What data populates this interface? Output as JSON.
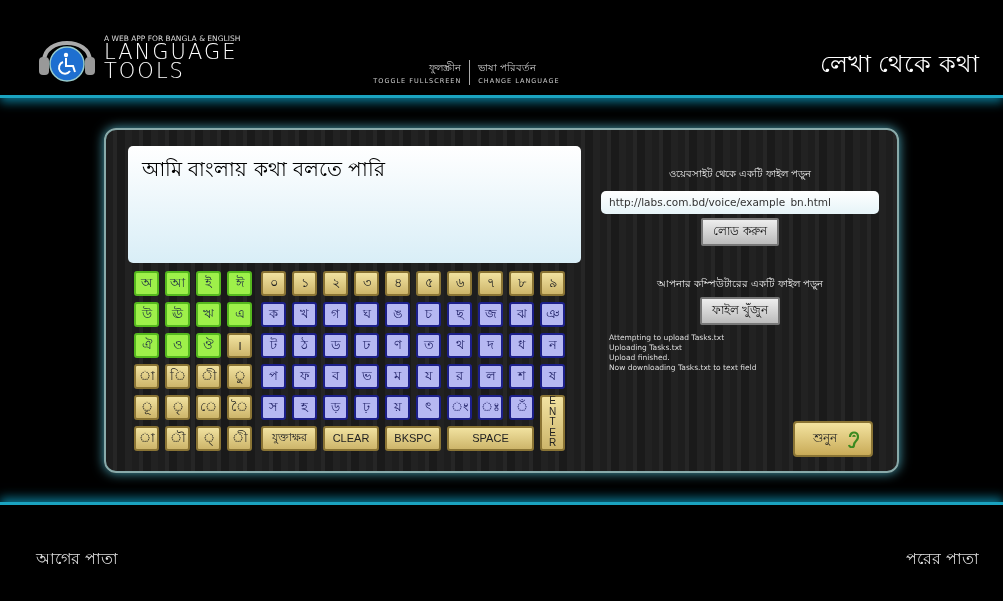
{
  "header": {
    "logo": {
      "tagline": "A WEB APP FOR BANGLA & ENGLISH",
      "line_1": "LANGUAGE",
      "line_2": "TOOLS"
    },
    "links": [
      {
        "bangla": "ফুলস্ক্রীন",
        "english": "TOGGLE FULLSCREEN"
      },
      {
        "bangla": "ভাষা পরিবর্তন",
        "english": "CHANGE LANGUAGE"
      }
    ],
    "title": "লেখা থেকে কথা"
  },
  "editor": {
    "text": "আমি বাংলায় কথা বলতে পারি"
  },
  "keyboard": {
    "left_rows": [
      [
        {
          "label": "অ",
          "kind": "vowel"
        },
        {
          "label": "আ",
          "kind": "vowel"
        },
        {
          "label": "ই",
          "kind": "vowel"
        },
        {
          "label": "ঈ",
          "kind": "vowel"
        }
      ],
      [
        {
          "label": "উ",
          "kind": "vowel"
        },
        {
          "label": "ঊ",
          "kind": "vowel"
        },
        {
          "label": "ঋ",
          "kind": "vowel"
        },
        {
          "label": "এ",
          "kind": "vowel"
        }
      ],
      [
        {
          "label": "ঐ",
          "kind": "vowel"
        },
        {
          "label": "ও",
          "kind": "vowel"
        },
        {
          "label": "ঔ",
          "kind": "vowel"
        },
        {
          "label": "।",
          "kind": "sign"
        }
      ],
      [
        {
          "label": "া",
          "kind": "sign"
        },
        {
          "label": "ি",
          "kind": "sign"
        },
        {
          "label": "ী",
          "kind": "sign"
        },
        {
          "label": "ু",
          "kind": "sign"
        }
      ],
      [
        {
          "label": "ূ",
          "kind": "sign"
        },
        {
          "label": "ৃ",
          "kind": "sign"
        },
        {
          "label": "ে",
          "kind": "sign"
        },
        {
          "label": "ৈ",
          "kind": "sign"
        }
      ],
      [
        {
          "label": "া",
          "kind": "sign"
        },
        {
          "label": "ৗ",
          "kind": "sign"
        },
        {
          "label": "্",
          "kind": "sign"
        },
        {
          "label": "ী",
          "kind": "sign"
        }
      ]
    ],
    "right_rows": [
      [
        {
          "label": "০",
          "kind": "digit"
        },
        {
          "label": "১",
          "kind": "digit"
        },
        {
          "label": "২",
          "kind": "digit"
        },
        {
          "label": "৩",
          "kind": "digit"
        },
        {
          "label": "৪",
          "kind": "digit"
        },
        {
          "label": "৫",
          "kind": "digit"
        },
        {
          "label": "৬",
          "kind": "digit"
        },
        {
          "label": "৭",
          "kind": "digit"
        },
        {
          "label": "৮",
          "kind": "digit"
        },
        {
          "label": "৯",
          "kind": "digit"
        }
      ],
      [
        {
          "label": "ক",
          "kind": "consonant"
        },
        {
          "label": "খ",
          "kind": "consonant"
        },
        {
          "label": "গ",
          "kind": "consonant"
        },
        {
          "label": "ঘ",
          "kind": "consonant"
        },
        {
          "label": "ঙ",
          "kind": "consonant"
        },
        {
          "label": "চ",
          "kind": "consonant"
        },
        {
          "label": "ছ",
          "kind": "consonant"
        },
        {
          "label": "জ",
          "kind": "consonant"
        },
        {
          "label": "ঝ",
          "kind": "consonant"
        },
        {
          "label": "ঞ",
          "kind": "consonant"
        }
      ],
      [
        {
          "label": "ট",
          "kind": "consonant"
        },
        {
          "label": "ঠ",
          "kind": "consonant"
        },
        {
          "label": "ড",
          "kind": "consonant"
        },
        {
          "label": "ঢ",
          "kind": "consonant"
        },
        {
          "label": "ণ",
          "kind": "consonant"
        },
        {
          "label": "ত",
          "kind": "consonant"
        },
        {
          "label": "থ",
          "kind": "consonant"
        },
        {
          "label": "দ",
          "kind": "consonant"
        },
        {
          "label": "ধ",
          "kind": "consonant"
        },
        {
          "label": "ন",
          "kind": "consonant"
        }
      ],
      [
        {
          "label": "প",
          "kind": "consonant"
        },
        {
          "label": "ফ",
          "kind": "consonant"
        },
        {
          "label": "ব",
          "kind": "consonant"
        },
        {
          "label": "ভ",
          "kind": "consonant"
        },
        {
          "label": "ম",
          "kind": "consonant"
        },
        {
          "label": "য",
          "kind": "consonant"
        },
        {
          "label": "র",
          "kind": "consonant"
        },
        {
          "label": "ল",
          "kind": "consonant"
        },
        {
          "label": "শ",
          "kind": "consonant"
        },
        {
          "label": "ষ",
          "kind": "consonant"
        }
      ],
      [
        {
          "label": "স",
          "kind": "consonant"
        },
        {
          "label": "হ",
          "kind": "consonant"
        },
        {
          "label": "ড়",
          "kind": "consonant"
        },
        {
          "label": "ঢ়",
          "kind": "consonant"
        },
        {
          "label": "য়",
          "kind": "consonant"
        },
        {
          "label": "ৎ",
          "kind": "consonant"
        },
        {
          "label": "ং",
          "kind": "consonant"
        },
        {
          "label": "ঃ",
          "kind": "consonant"
        },
        {
          "label": "ঁ",
          "kind": "consonant"
        },
        {
          "label": "ENTER",
          "kind": "enter"
        }
      ],
      [
        {
          "label": "যুক্তাক্ষর",
          "kind": "function"
        },
        {
          "label": "CLEAR",
          "kind": "function"
        },
        {
          "label": "BKSPC",
          "kind": "function"
        },
        {
          "label": "SPACE",
          "kind": "space"
        }
      ]
    ]
  },
  "web_file": {
    "label": "ওয়েবসাইট থেকে একটি ফাইল পড়ুন",
    "url": "http://labs.com.bd/voice/example_bn.html",
    "button": "লোড করুন"
  },
  "local_file": {
    "label": "আপনার কম্পিউটারের একটি ফাইল পড়ুন",
    "button": "ফাইল খুঁজুন"
  },
  "log": [
    "Attempting to upload Tasks.txt",
    "Uploading Tasks.txt",
    "Upload finished.",
    "Now downloading Tasks.txt to text field"
  ],
  "speak_button": "শুনুন",
  "footer": {
    "previous": "আগের পাতা",
    "next": "পরের পাতা"
  }
}
